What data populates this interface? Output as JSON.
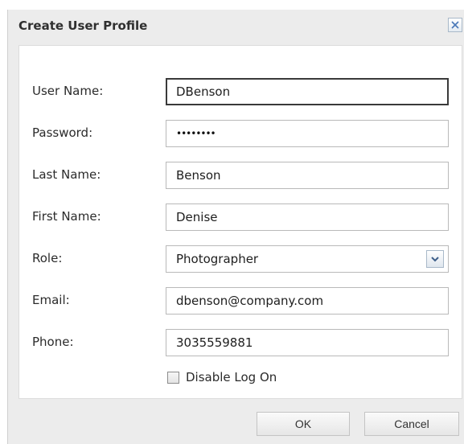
{
  "dialog": {
    "title": "Create User Profile",
    "close_icon": "close-icon"
  },
  "form": {
    "username": {
      "label": "User Name:",
      "value": "DBenson"
    },
    "password": {
      "label": "Password:",
      "masked": "••••••••"
    },
    "last_name": {
      "label": "Last Name:",
      "value": "Benson"
    },
    "first_name": {
      "label": "First Name:",
      "value": "Denise"
    },
    "role": {
      "label": "Role:",
      "value": "Photographer",
      "icon": "chevron-down-icon"
    },
    "email": {
      "label": "Email:",
      "value": "dbenson@company.com"
    },
    "phone": {
      "label": "Phone:",
      "value": "3035559881"
    },
    "disable_logon": {
      "label": "Disable Log On",
      "checked": false
    }
  },
  "buttons": {
    "ok": "OK",
    "cancel": "Cancel"
  },
  "colors": {
    "dialog_bg": "#ececec",
    "panel_bg": "#ffffff",
    "accent_blue": "#4a78b8"
  }
}
